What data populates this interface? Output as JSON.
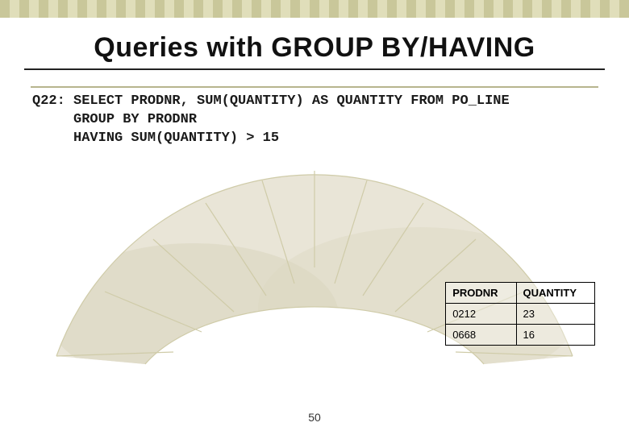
{
  "header": {
    "title": "Queries with GROUP BY/HAVING"
  },
  "query": {
    "label": "Q22:",
    "line1": "SELECT PRODNR, SUM(QUANTITY) AS QUANTITY FROM PO_LINE",
    "line2": "GROUP BY PRODNR",
    "line3": "HAVING SUM(QUANTITY) > 15"
  },
  "table": {
    "headers": {
      "col1": "PRODNR",
      "col2": "QUANTITY"
    },
    "rows": [
      {
        "col1": "0212",
        "col2": "23"
      },
      {
        "col1": "0668",
        "col2": "16"
      }
    ]
  },
  "footer": {
    "page_number": "50"
  },
  "chart_data": {
    "type": "table",
    "title": "Queries with GROUP BY/HAVING",
    "sql": "SELECT PRODNR, SUM(QUANTITY) AS QUANTITY FROM PO_LINE GROUP BY PRODNR HAVING SUM(QUANTITY) > 15",
    "columns": [
      "PRODNR",
      "QUANTITY"
    ],
    "rows": [
      [
        "0212",
        23
      ],
      [
        "0668",
        16
      ]
    ]
  }
}
